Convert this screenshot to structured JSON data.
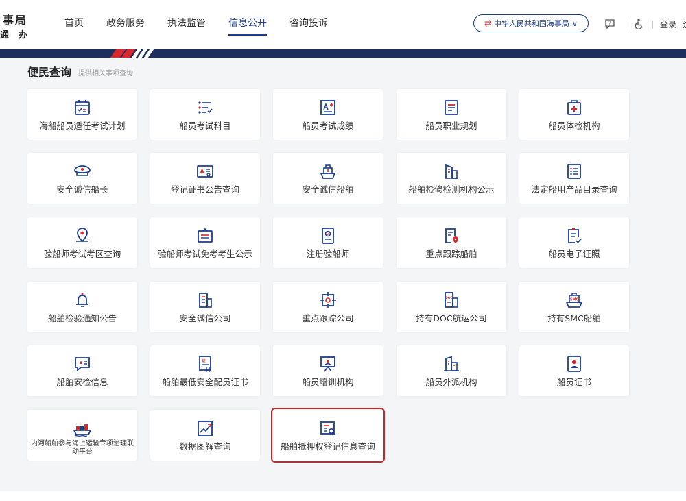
{
  "header": {
    "logo_line1": "事局",
    "logo_line2": "通办",
    "nav": [
      "首页",
      "政务服务",
      "执法监管",
      "信息公开",
      "咨询投诉"
    ],
    "active_nav": 3,
    "region": "中华人民共和国海事局",
    "login": "登录",
    "login_tail": "注"
  },
  "colors": {
    "brand": "#1b3d8f",
    "accent_red": "#d9272e",
    "highlight": "#c62828"
  },
  "section": {
    "title": "便民查询",
    "subtitle": "提供相关事项查询"
  },
  "tiles": [
    {
      "label": "海船船员适任考试计划",
      "icon": "calendar-icon"
    },
    {
      "label": "船员考试科目",
      "icon": "checklist-icon"
    },
    {
      "label": "船员考试成绩",
      "icon": "score-icon"
    },
    {
      "label": "船员职业规划",
      "icon": "document-icon"
    },
    {
      "label": "船员体检机构",
      "icon": "medical-icon"
    },
    {
      "label": "安全诚信船长",
      "icon": "captain-hat-icon"
    },
    {
      "label": "登记证书公告查询",
      "icon": "certificate-icon"
    },
    {
      "label": "安全诚信船舶",
      "icon": "ship-icon"
    },
    {
      "label": "船舶检修检测机构公示",
      "icon": "building-icon"
    },
    {
      "label": "法定船用产品目录查询",
      "icon": "list-icon"
    },
    {
      "label": "验船师考试考区查询",
      "icon": "location-icon"
    },
    {
      "label": "验船师考试免考考生公示",
      "icon": "board-icon"
    },
    {
      "label": "注册验船师",
      "icon": "id-card-icon"
    },
    {
      "label": "重点跟踪船舶",
      "icon": "doc-pin-icon"
    },
    {
      "label": "船员电子证照",
      "icon": "e-license-icon"
    },
    {
      "label": "船舶检验通知公告",
      "icon": "bell-icon"
    },
    {
      "label": "安全诚信公司",
      "icon": "office-icon"
    },
    {
      "label": "重点跟踪公司",
      "icon": "target-icon"
    },
    {
      "label": "持有DOC航运公司",
      "icon": "doc-building-icon"
    },
    {
      "label": "持有SMC船舶",
      "icon": "smc-ship-icon"
    },
    {
      "label": "船舶安检信息",
      "icon": "chat-alert-icon"
    },
    {
      "label": "船舶最低安全配员证书",
      "icon": "certificate-doc-icon"
    },
    {
      "label": "船员培训机构",
      "icon": "training-icon"
    },
    {
      "label": "船员外派机构",
      "icon": "buildings-icon"
    },
    {
      "label": "船员证书",
      "icon": "person-card-icon"
    },
    {
      "label": "内河船舶参与海上运输专项治理联动平台",
      "icon": "cargo-ship-icon"
    },
    {
      "label": "数据图解查询",
      "icon": "chart-icon"
    },
    {
      "label": "船舶抵押权登记信息查询",
      "icon": "search-doc-icon"
    }
  ]
}
